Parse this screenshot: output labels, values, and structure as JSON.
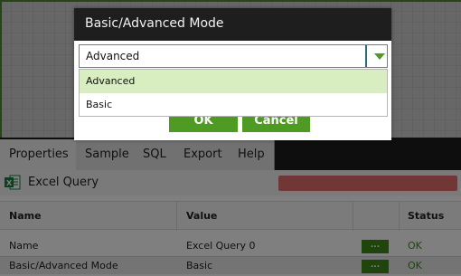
{
  "tabs": [
    {
      "label": "Properties"
    },
    {
      "label": "Sample"
    },
    {
      "label": "SQL"
    },
    {
      "label": "Export"
    },
    {
      "label": "Help"
    }
  ],
  "query": {
    "title": "Excel Query",
    "icon": "excel-icon"
  },
  "grid": {
    "headers": {
      "name": "Name",
      "value": "Value",
      "status": "Status"
    },
    "rows": [
      {
        "name": "Name",
        "value": "Excel Query 0",
        "button": "...",
        "status": "OK"
      },
      {
        "name": "Basic/Advanced Mode",
        "value": "Basic",
        "button": "...",
        "status": "OK"
      }
    ]
  },
  "modal": {
    "title": "Basic/Advanced Mode",
    "select_value": "Advanced",
    "options": [
      {
        "label": "Advanced"
      },
      {
        "label": "Basic"
      }
    ],
    "ok_label": "OK",
    "cancel_label": "Cancel"
  },
  "colors": {
    "accent_green": "#4f9a22",
    "option_highlight": "#d8eec1",
    "header_dark": "#1e1e1e",
    "status_ok": "#3a8a1a"
  }
}
